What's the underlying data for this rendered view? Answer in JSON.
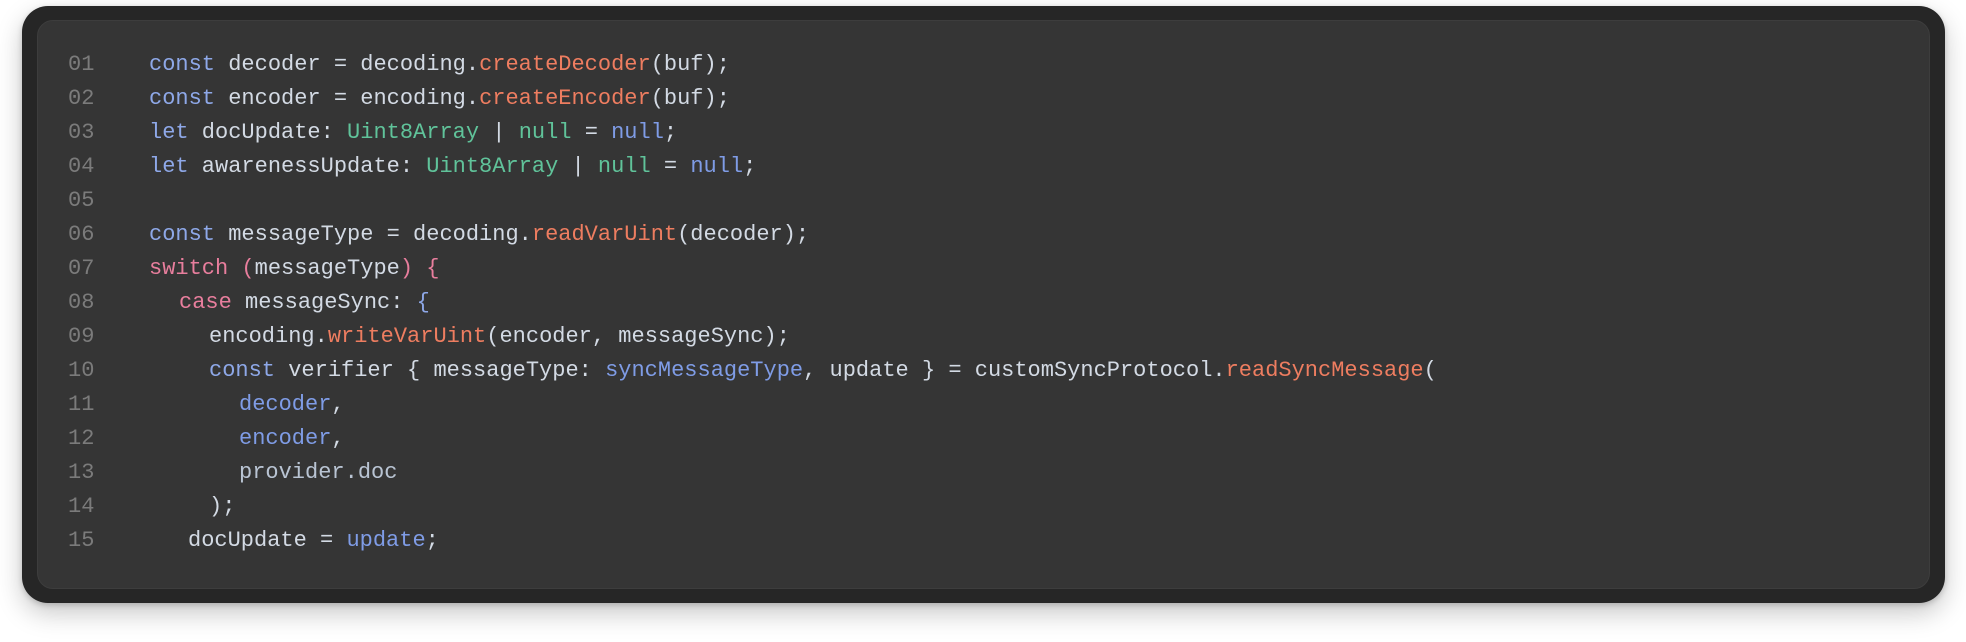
{
  "colors": {
    "background": "#262626",
    "panel": "#353535",
    "line_number": "#7b7b7b",
    "text": "#d3dae4",
    "keyword": "#8ea8e8",
    "control_keyword": "#e87e9d",
    "function": "#ee7d60",
    "type": "#60c39a",
    "variable": "#7f9ce6"
  },
  "lines": [
    {
      "number": "01",
      "indent": 0,
      "tokens": [
        {
          "t": "const",
          "c": "keyword"
        },
        {
          "t": " decoder = decoding.",
          "c": "text"
        },
        {
          "t": "createDecoder",
          "c": "func"
        },
        {
          "t": "(buf);",
          "c": "text"
        }
      ]
    },
    {
      "number": "02",
      "indent": 0,
      "tokens": [
        {
          "t": "const",
          "c": "keyword"
        },
        {
          "t": " encoder = encoding.",
          "c": "text"
        },
        {
          "t": "createEncoder",
          "c": "func"
        },
        {
          "t": "(buf);",
          "c": "text"
        }
      ]
    },
    {
      "number": "03",
      "indent": 0,
      "tokens": [
        {
          "t": "let",
          "c": "keyword"
        },
        {
          "t": " docUpdate: ",
          "c": "text"
        },
        {
          "t": "Uint8Array",
          "c": "type"
        },
        {
          "t": " | ",
          "c": "text"
        },
        {
          "t": "null",
          "c": "type"
        },
        {
          "t": " = ",
          "c": "text"
        },
        {
          "t": "null",
          "c": "var"
        },
        {
          "t": ";",
          "c": "text"
        }
      ]
    },
    {
      "number": "04",
      "indent": 0,
      "tokens": [
        {
          "t": "let",
          "c": "keyword"
        },
        {
          "t": " awarenessUpdate: ",
          "c": "text"
        },
        {
          "t": "Uint8Array",
          "c": "type"
        },
        {
          "t": " | ",
          "c": "text"
        },
        {
          "t": "null",
          "c": "type"
        },
        {
          "t": " = ",
          "c": "text"
        },
        {
          "t": "null",
          "c": "var"
        },
        {
          "t": ";",
          "c": "text"
        }
      ]
    },
    {
      "number": "05",
      "indent": 0,
      "tokens": []
    },
    {
      "number": "06",
      "indent": 0,
      "tokens": [
        {
          "t": "const",
          "c": "keyword"
        },
        {
          "t": " messageType = decoding.",
          "c": "text"
        },
        {
          "t": "readVarUint",
          "c": "func"
        },
        {
          "t": "(decoder);",
          "c": "text"
        }
      ]
    },
    {
      "number": "07",
      "indent": 0,
      "tokens": [
        {
          "t": "switch",
          "c": "keyword2"
        },
        {
          "t": " (",
          "c": "keyword2"
        },
        {
          "t": "messageType",
          "c": "text"
        },
        {
          "t": ") {",
          "c": "keyword2"
        }
      ]
    },
    {
      "number": "08",
      "indent": 1,
      "tokens": [
        {
          "t": "case",
          "c": "keyword2"
        },
        {
          "t": " messageSync: ",
          "c": "text"
        },
        {
          "t": "{",
          "c": "keyword"
        }
      ]
    },
    {
      "number": "09",
      "indent": 2,
      "tokens": [
        {
          "t": "encoding.",
          "c": "text"
        },
        {
          "t": "writeVarUint",
          "c": "func"
        },
        {
          "t": "(encoder, messageSync);",
          "c": "text"
        }
      ]
    },
    {
      "number": "10",
      "indent": 2,
      "tokens": [
        {
          "t": "const",
          "c": "keyword"
        },
        {
          "t": " verifier { messageType: ",
          "c": "text"
        },
        {
          "t": "syncMessageType",
          "c": "var"
        },
        {
          "t": ", update } = customSyncProtocol.",
          "c": "text"
        },
        {
          "t": "readSyncMessage",
          "c": "func"
        },
        {
          "t": "(",
          "c": "text"
        }
      ]
    },
    {
      "number": "11",
      "indent": 3,
      "tokens": [
        {
          "t": "decoder",
          "c": "var"
        },
        {
          "t": ",",
          "c": "text"
        }
      ]
    },
    {
      "number": "12",
      "indent": 3,
      "tokens": [
        {
          "t": "encoder",
          "c": "var"
        },
        {
          "t": ",",
          "c": "text"
        }
      ]
    },
    {
      "number": "13",
      "indent": 3,
      "tokens": [
        {
          "t": "provider.doc",
          "c": "param"
        }
      ]
    },
    {
      "number": "14",
      "indent": 2,
      "tokens": [
        {
          "t": ");",
          "c": "text"
        }
      ]
    },
    {
      "number": "15",
      "indent": 1.3,
      "tokens": [
        {
          "t": "docUpdate = ",
          "c": "text"
        },
        {
          "t": "update",
          "c": "var"
        },
        {
          "t": ";",
          "c": "text"
        }
      ]
    }
  ]
}
